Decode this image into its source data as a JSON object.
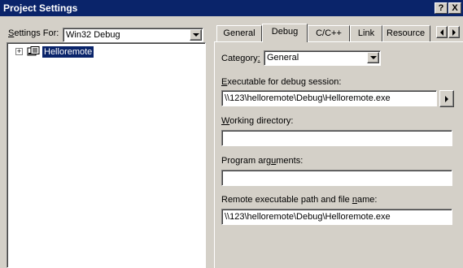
{
  "window": {
    "title": "Project Settings",
    "help_label": "?",
    "close_label": "X"
  },
  "settings_for": {
    "label_prefix": "S",
    "label_rest": "ettings For:",
    "value": "Win32 Debug"
  },
  "tree": {
    "expander": "+",
    "items": [
      {
        "label": "Helloremote"
      }
    ]
  },
  "tabs": [
    {
      "label": "General"
    },
    {
      "label": "Debug",
      "active": true
    },
    {
      "label": "C/C++"
    },
    {
      "label": "Link"
    },
    {
      "label": "Resource"
    }
  ],
  "debug": {
    "category_label_prefix": "Category",
    "category_label_underline": ":",
    "category_value": "General",
    "executable_label_u": "E",
    "executable_label_rest": "xecutable for debug session:",
    "executable_value": "\\\\123\\helloremote\\Debug\\Helloremote.exe",
    "working_dir_label_u": "W",
    "working_dir_label_rest": "orking directory:",
    "working_dir_value": "",
    "program_args_label_pre": "Program arg",
    "program_args_label_u": "u",
    "program_args_label_rest": "ments:",
    "program_args_value": "",
    "remote_label_pre": "Remote executable path and file ",
    "remote_label_u": "n",
    "remote_label_rest": "ame:",
    "remote_value": "\\\\123\\helloremote\\Debug\\Helloremote.exe"
  }
}
